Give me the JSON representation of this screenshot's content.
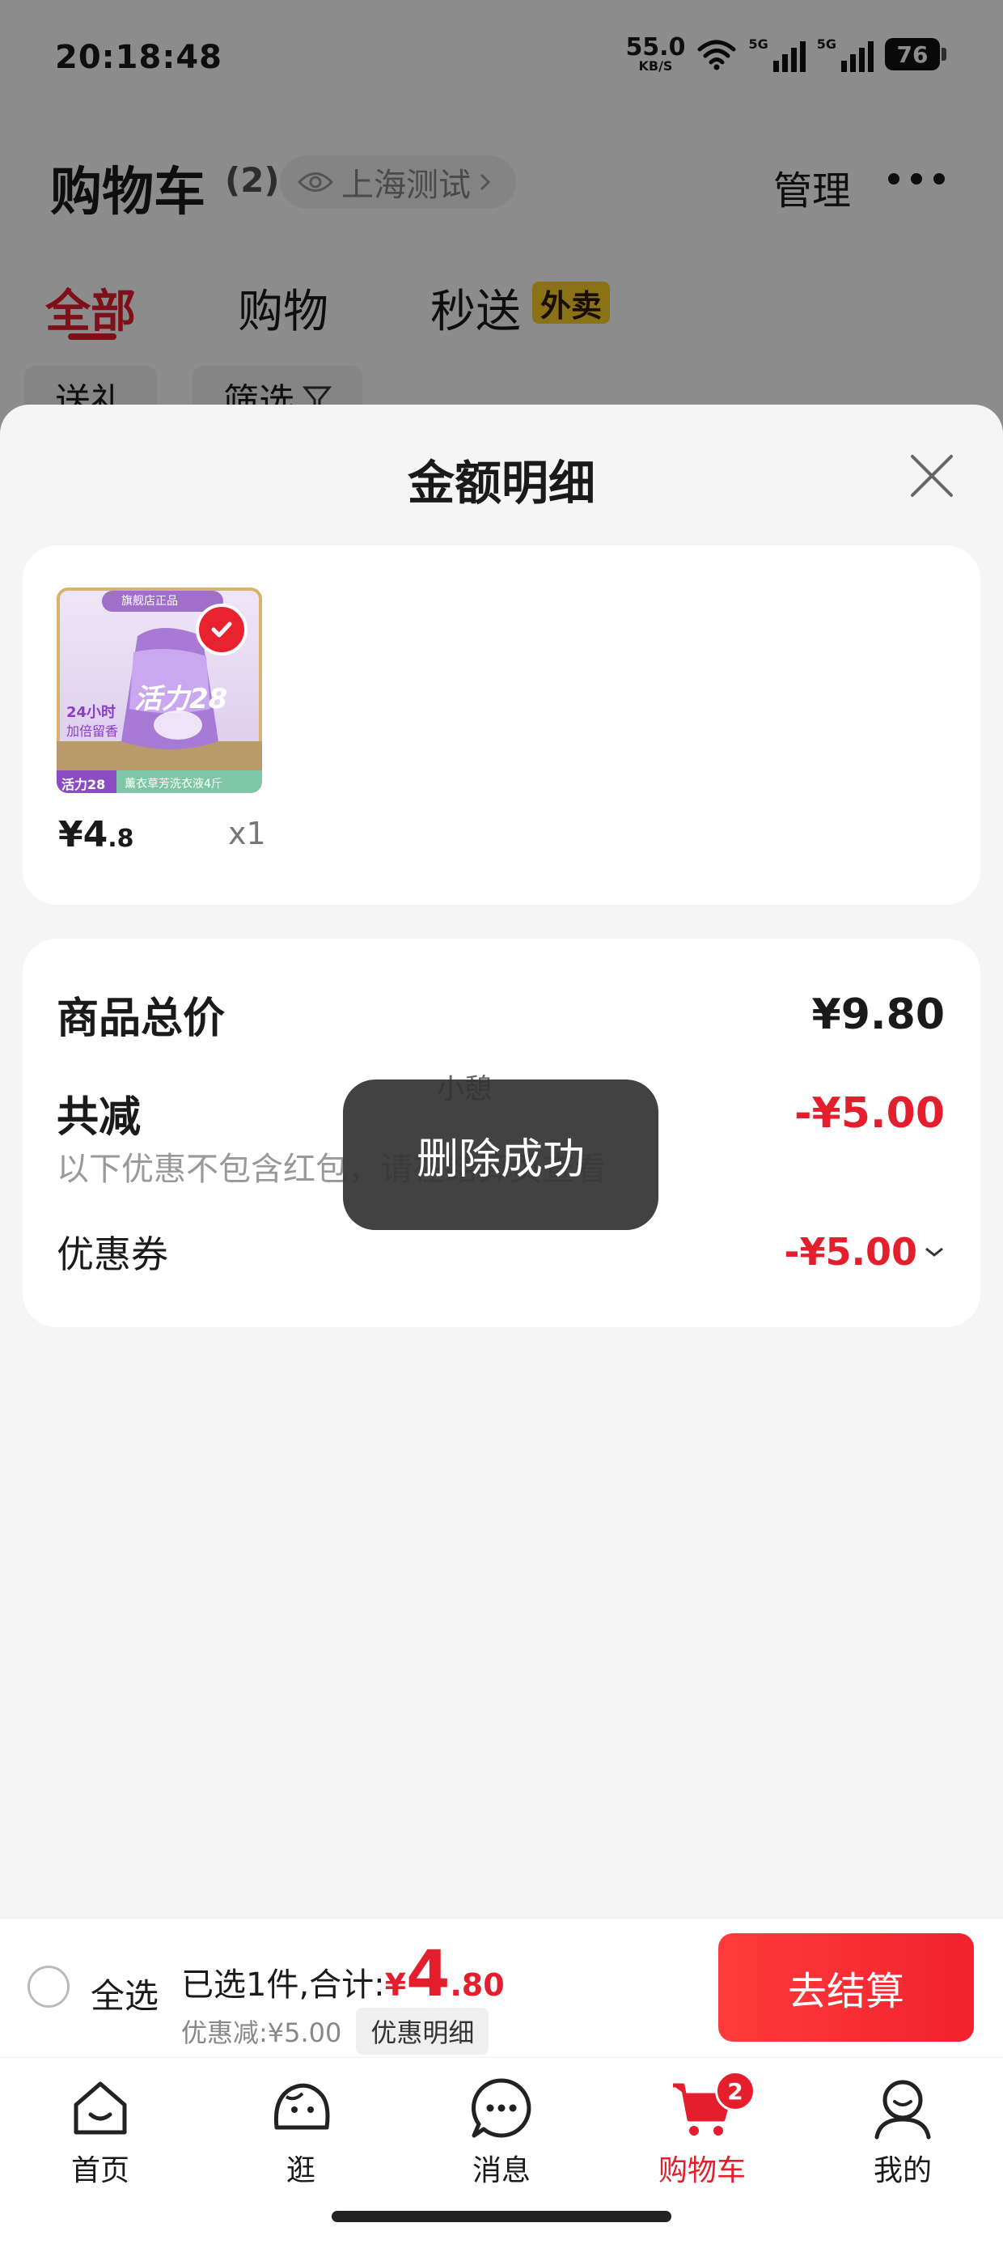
{
  "status_bar": {
    "time": "20:18:48",
    "net_speed": "55.0",
    "net_unit": "KB/S",
    "signal1_label": "5G",
    "signal2_label": "5G",
    "battery": "76"
  },
  "header": {
    "title": "购物车",
    "count": "(2)",
    "location": "上海测试",
    "manage": "管理"
  },
  "tabs": [
    {
      "label": "全部",
      "active": true
    },
    {
      "label": "购物",
      "active": false
    },
    {
      "label": "秒送",
      "active": false,
      "badge": "外卖"
    }
  ],
  "chips": [
    "送礼",
    "筛选"
  ],
  "sheet": {
    "title": "金额明细",
    "product": {
      "price_int": "¥4",
      "price_dec": ".8",
      "qty": "x1",
      "image_texts": {
        "brand": "活力28",
        "top": "旗舰店正品",
        "side1": "24小时",
        "side2": "加倍留香",
        "bottom": "薰衣草芳洗衣液4斤"
      }
    },
    "summary": {
      "total_label": "商品总价",
      "total_value": "¥9.80",
      "reduce_label": "共减",
      "reduce_value": "-¥5.00",
      "note": "以下优惠不包含红包，请在结算页查看",
      "coupon_label": "优惠券",
      "coupon_value": "-¥5.00"
    }
  },
  "toast": {
    "above_text": "小憩",
    "text": "删除成功"
  },
  "checkout": {
    "select_all": "全选",
    "selected_text": "已选1件,合计:",
    "total_currency": "¥",
    "total_int": "4",
    "total_dec": ".80",
    "discount_text": "优惠减:¥5.00",
    "detail_chip": "优惠明细",
    "button": "去结算"
  },
  "nav": {
    "items": [
      {
        "label": "首页",
        "icon": "home-icon"
      },
      {
        "label": "逛",
        "icon": "explore-icon"
      },
      {
        "label": "消息",
        "icon": "message-icon"
      },
      {
        "label": "购物车",
        "icon": "cart-icon",
        "badge": "2",
        "active": true
      },
      {
        "label": "我的",
        "icon": "profile-icon"
      }
    ]
  },
  "colors": {
    "accent": "#e41e2c",
    "badge_yellow": "#ffcf2a",
    "background": "#f5f5f5"
  }
}
